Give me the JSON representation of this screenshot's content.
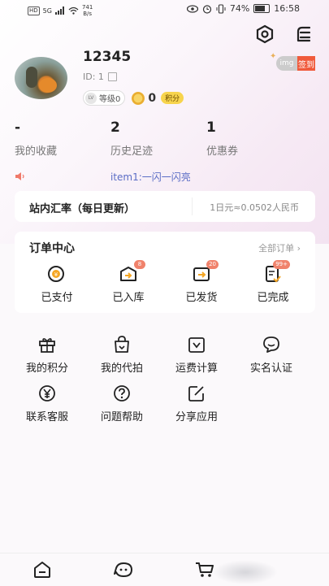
{
  "status_bar": {
    "net_label": "HD",
    "signal_label": "5G",
    "speed_value": "741",
    "speed_unit": "B/s",
    "battery": "74%",
    "time": "16:58"
  },
  "profile": {
    "username": "12345",
    "id_text": "ID: 1",
    "level_label": "等级0",
    "lv_mark": "LV",
    "points_value": "0",
    "points_tag": "积分",
    "signin_img": "img",
    "signin_label": "签到"
  },
  "stats": [
    {
      "value": "-",
      "label": "我的收藏"
    },
    {
      "value": "2",
      "label": "历史足迹"
    },
    {
      "value": "1",
      "label": "优惠券"
    }
  ],
  "notice": {
    "text": "item1:一闪一闪亮"
  },
  "exchange": {
    "title": "站内汇率（每日更新）",
    "value": "1日元≈0.0502人民币"
  },
  "orders": {
    "title": "订单中心",
    "all_label": "全部订单 ›",
    "items": [
      {
        "label": "已支付",
        "icon": "yen-clock-icon",
        "badge": ""
      },
      {
        "label": "已入库",
        "icon": "inbound-box-icon",
        "badge": "8"
      },
      {
        "label": "已发货",
        "icon": "shipped-box-icon",
        "badge": "20"
      },
      {
        "label": "已完成",
        "icon": "done-doc-icon",
        "badge": "99+"
      }
    ]
  },
  "tools": [
    {
      "label": "我的积分",
      "icon": "gift-icon"
    },
    {
      "label": "我的代拍",
      "icon": "bag-icon"
    },
    {
      "label": "运费计算",
      "icon": "freight-icon"
    },
    {
      "label": "实名认证",
      "icon": "chat-bubble-icon"
    },
    {
      "label": "联系客服",
      "icon": "yen-circle-icon"
    },
    {
      "label": "问题帮助",
      "icon": "question-icon"
    },
    {
      "label": "分享应用",
      "icon": "edit-icon"
    }
  ],
  "bottom_nav": [
    {
      "icon": "home-icon"
    },
    {
      "icon": "chat-face-icon"
    },
    {
      "icon": "cart-icon"
    }
  ]
}
